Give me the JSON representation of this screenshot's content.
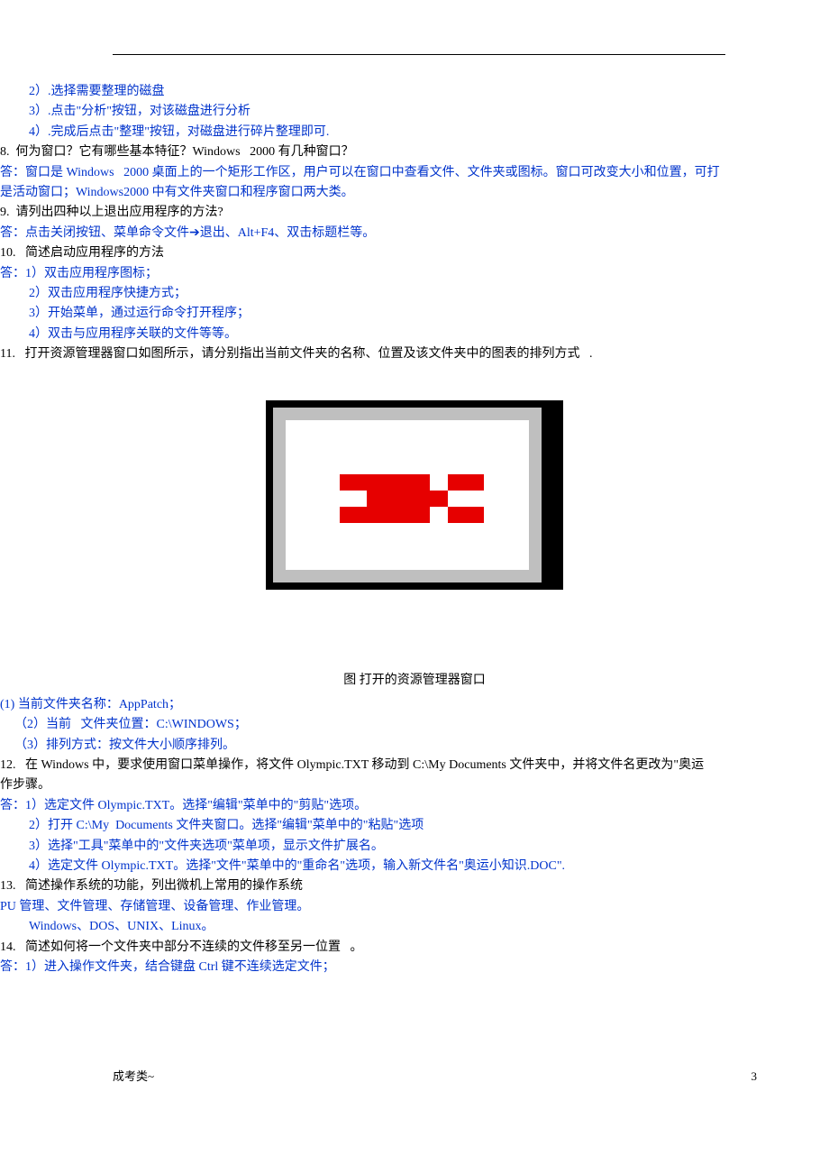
{
  "lines": {
    "l1": "2）.选择需要整理的磁盘",
    "l2": "3）.点击\"分析\"按钮，对该磁盘进行分析",
    "l3": "4）.完成后点击\"整理\"按钮，对磁盘进行碎片整理即可.",
    "q8": "8.  何为窗口？它有哪些基本特征？Windows   2000 有几种窗口？",
    "a8a": "答：窗口是 Windows   2000 桌面上的一个矩形工作区，用户可以在窗口中查看文件、文件夹或图标。窗口可改变大小和位置，可打",
    "a8b": "是活动窗口；Windows2000 中有文件夹窗口和程序窗口两大类。",
    "q9": "9.  请列出四种以上退出应用程序的方法?",
    "a9": "答：点击关闭按钮、菜单命令文件➔退出、Alt+F4、双击标题栏等。",
    "q10": "10.   简述启动应用程序的方法",
    "a10a": "答：1）双击应用程序图标；",
    "a10b": "2）双击应用程序快捷方式；",
    "a10c": "3）开始菜单，通过运行命令打开程序；",
    "a10d": "4）双击与应用程序关联的文件等等。",
    "q11": "11.   打开资源管理器窗口如图所示，请分别指出当前文件夹的名称、位置及该文件夹中的图表的排列方式   .",
    "caption": "图   打开的资源管理器窗口",
    "a11a": "(1) 当前文件夹名称：AppPatch；",
    "a11b": "（2）当前   文件夹位置：C:\\WINDOWS；",
    "a11c": "（3）排列方式：按文件大小顺序排列。",
    "q12": "12.   在 Windows 中，要求使用窗口菜单操作，将文件 Olympic.TXT 移动到 C:\\My Documents 文件夹中，并将文件名更改为\"奥运",
    "q12b": "作步骤。",
    "a12a": "答：1）选定文件 Olympic.TXT。选择\"编辑\"菜单中的\"剪贴\"选项。",
    "a12b": "2）打开 C:\\My  Documents 文件夹窗口。选择\"编辑\"菜单中的\"粘贴\"选项",
    "a12c": "3）选择\"工具\"菜单中的\"文件夹选项\"菜单项，显示文件扩展名。",
    "a12d": "4）选定文件 Olympic.TXT。选择\"文件\"菜单中的\"重命名\"选项，输入新文件名\"奥运小知识.DOC\".",
    "q13": "13.   简述操作系统的功能，列出微机上常用的操作系统",
    "a13a": "PU 管理、文件管理、存储管理、设备管理、作业管理。",
    "a13b": "Windows、DOS、UNIX、Linux。",
    "q14": "14.   简述如何将一个文件夹中部分不连续的文件移至另一位置   。",
    "a14a": "答：1）进入操作文件夹，结合键盘 Ctrl 键不连续选定文件；"
  },
  "footer": {
    "left": "成考类~",
    "right": "3"
  }
}
